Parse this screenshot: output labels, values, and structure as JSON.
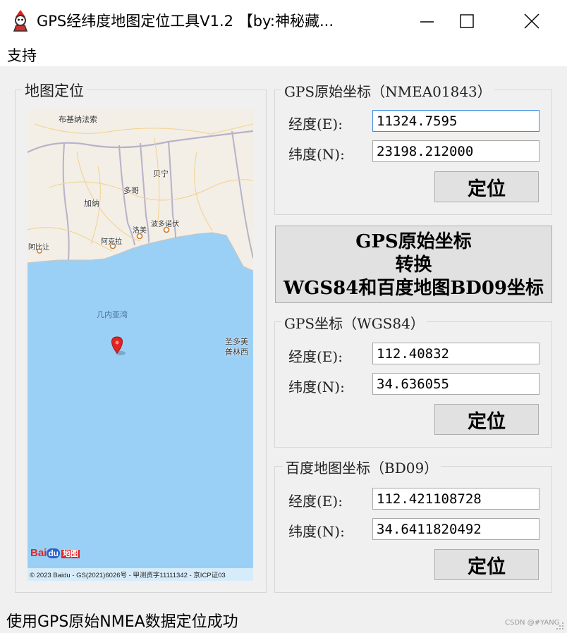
{
  "window": {
    "title": "GPS经纬度地图定位工具V1.2 【by:神秘藏...",
    "buttons": [
      "minimize",
      "maximize",
      "close"
    ]
  },
  "menu": {
    "support": "支持"
  },
  "map_group": {
    "title": "地图定位",
    "cities": {
      "burkina": "布基纳法索",
      "benin": "贝宁",
      "togo": "多哥",
      "ghana": "加纳",
      "lome": "洛美",
      "porto_novo": "波多诺伏",
      "accra": "阿克拉",
      "abidjan": "阿比让",
      "gulf": "几内亚湾",
      "sao_tome_1": "圣多美",
      "sao_tome_2": "普林西"
    },
    "logo": {
      "bai": "Bai",
      "du": "du",
      "ditu": "地图"
    },
    "copyright": "© 2023 Baidu - GS(2021)6026号 - 甲测资字11111342 - 京ICP证03"
  },
  "nmea_group": {
    "title": "GPS原始坐标（NMEA01843）",
    "lon_label": "经度(E):",
    "lat_label": "纬度(N):",
    "lon_value": "11324.7595",
    "lat_value": "23198.212000",
    "locate_label": "定位"
  },
  "convert_button": {
    "line1": "GPS原始坐标",
    "line2": "转换",
    "line3": "WGS84和百度地图BD09坐标"
  },
  "wgs_group": {
    "title": "GPS坐标（WGS84）",
    "lon_label": "经度(E):",
    "lat_label": "纬度(N):",
    "lon_value": "112.40832",
    "lat_value": "34.636055",
    "locate_label": "定位"
  },
  "bd_group": {
    "title": "百度地图坐标（BD09）",
    "lon_label": "经度(E):",
    "lat_label": "纬度(N):",
    "lon_value": "112.421108728",
    "lat_value": "34.6411820492",
    "locate_label": "定位"
  },
  "status": {
    "text": "使用GPS原始NMEA数据定位成功"
  },
  "watermark": "CSDN @#YANG",
  "colors": {
    "water": "#9bd0f6",
    "land": "#f3eee6",
    "focus_border": "#3d8ee0",
    "marker": "#e02424"
  }
}
